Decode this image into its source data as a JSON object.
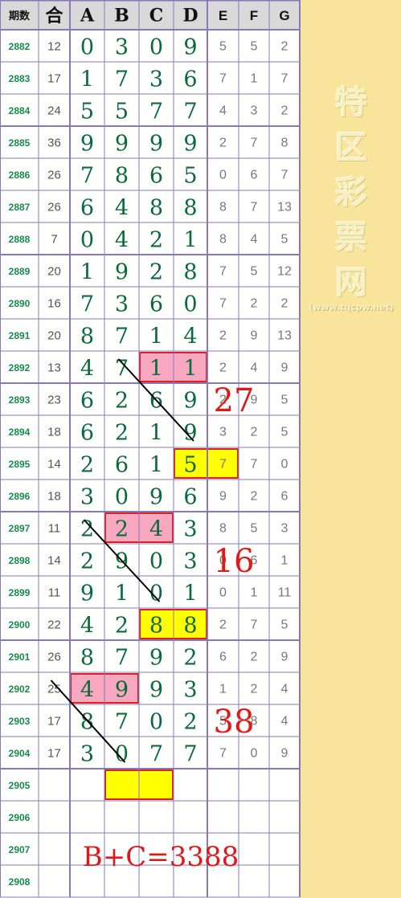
{
  "headers": [
    "期数",
    "合",
    "A",
    "B",
    "C",
    "D",
    "E",
    "F",
    "G"
  ],
  "rows": [
    {
      "issue": "2882",
      "sum": "12",
      "a": "0",
      "b": "3",
      "c": "0",
      "d": "9",
      "e": "5",
      "f": "5",
      "g": "2"
    },
    {
      "issue": "2883",
      "sum": "17",
      "a": "1",
      "b": "7",
      "c": "3",
      "d": "6",
      "e": "7",
      "f": "1",
      "g": "7"
    },
    {
      "issue": "2884",
      "sum": "24",
      "a": "5",
      "b": "5",
      "c": "7",
      "d": "7",
      "e": "4",
      "f": "3",
      "g": "2"
    },
    {
      "issue": "2885",
      "sum": "36",
      "a": "9",
      "b": "9",
      "c": "9",
      "d": "9",
      "e": "2",
      "f": "7",
      "g": "8"
    },
    {
      "issue": "2886",
      "sum": "26",
      "a": "7",
      "b": "8",
      "c": "6",
      "d": "5",
      "e": "0",
      "f": "6",
      "g": "7"
    },
    {
      "issue": "2887",
      "sum": "26",
      "a": "6",
      "b": "4",
      "c": "8",
      "d": "8",
      "e": "8",
      "f": "7",
      "g": "13"
    },
    {
      "issue": "2888",
      "sum": "7",
      "a": "0",
      "b": "4",
      "c": "2",
      "d": "1",
      "e": "8",
      "f": "4",
      "g": "5"
    },
    {
      "issue": "2889",
      "sum": "20",
      "a": "1",
      "b": "9",
      "c": "2",
      "d": "8",
      "e": "7",
      "f": "5",
      "g": "12"
    },
    {
      "issue": "2890",
      "sum": "16",
      "a": "7",
      "b": "3",
      "c": "6",
      "d": "0",
      "e": "7",
      "f": "2",
      "g": "2"
    },
    {
      "issue": "2891",
      "sum": "20",
      "a": "8",
      "b": "7",
      "c": "1",
      "d": "4",
      "e": "2",
      "f": "9",
      "g": "13"
    },
    {
      "issue": "2892",
      "sum": "13",
      "a": "4",
      "b": "7",
      "c": "1",
      "d": "1",
      "e": "2",
      "f": "4",
      "g": "9"
    },
    {
      "issue": "2893",
      "sum": "23",
      "a": "6",
      "b": "2",
      "c": "6",
      "d": "9",
      "e": "2",
      "f": "9",
      "g": "5"
    },
    {
      "issue": "2894",
      "sum": "18",
      "a": "6",
      "b": "2",
      "c": "1",
      "d": "9",
      "e": "3",
      "f": "2",
      "g": "5"
    },
    {
      "issue": "2895",
      "sum": "14",
      "a": "2",
      "b": "6",
      "c": "1",
      "d": "5",
      "e": "7",
      "f": "7",
      "g": "0"
    },
    {
      "issue": "2896",
      "sum": "18",
      "a": "3",
      "b": "0",
      "c": "9",
      "d": "6",
      "e": "9",
      "f": "2",
      "g": "6"
    },
    {
      "issue": "2897",
      "sum": "11",
      "a": "2",
      "b": "2",
      "c": "4",
      "d": "3",
      "e": "8",
      "f": "5",
      "g": "3"
    },
    {
      "issue": "2898",
      "sum": "14",
      "a": "2",
      "b": "9",
      "c": "0",
      "d": "3",
      "e": "0",
      "f": "6",
      "g": "1"
    },
    {
      "issue": "2899",
      "sum": "11",
      "a": "9",
      "b": "1",
      "c": "0",
      "d": "1",
      "e": "0",
      "f": "1",
      "g": "11"
    },
    {
      "issue": "2900",
      "sum": "22",
      "a": "4",
      "b": "2",
      "c": "8",
      "d": "8",
      "e": "2",
      "f": "7",
      "g": "5"
    },
    {
      "issue": "2901",
      "sum": "26",
      "a": "8",
      "b": "7",
      "c": "9",
      "d": "2",
      "e": "6",
      "f": "2",
      "g": "9"
    },
    {
      "issue": "2902",
      "sum": "25",
      "a": "4",
      "b": "9",
      "c": "9",
      "d": "3",
      "e": "1",
      "f": "2",
      "g": "4"
    },
    {
      "issue": "2903",
      "sum": "17",
      "a": "8",
      "b": "7",
      "c": "0",
      "d": "2",
      "e": "5",
      "f": "8",
      "g": "4"
    },
    {
      "issue": "2904",
      "sum": "17",
      "a": "3",
      "b": "0",
      "c": "7",
      "d": "7",
      "e": "7",
      "f": "0",
      "g": "9"
    },
    {
      "issue": "2905",
      "sum": "",
      "a": "",
      "b": "",
      "c": "",
      "d": "",
      "e": "",
      "f": "",
      "g": ""
    },
    {
      "issue": "2906",
      "sum": "",
      "a": "",
      "b": "",
      "c": "",
      "d": "",
      "e": "",
      "f": "",
      "g": ""
    },
    {
      "issue": "2907",
      "sum": "",
      "a": "",
      "b": "",
      "c": "",
      "d": "",
      "e": "",
      "f": "",
      "g": ""
    },
    {
      "issue": "2908",
      "sum": "",
      "a": "",
      "b": "",
      "c": "",
      "d": "",
      "e": "",
      "f": "",
      "g": ""
    }
  ],
  "highlights": [
    {
      "row": 10,
      "cols": [
        4,
        5
      ],
      "color": "#f7a8c0"
    },
    {
      "row": 13,
      "cols": [
        5,
        6
      ],
      "color": "#ffff00"
    },
    {
      "row": 15,
      "cols": [
        3,
        4
      ],
      "color": "#f7a8c0"
    },
    {
      "row": 18,
      "cols": [
        4,
        5
      ],
      "color": "#ffff00"
    },
    {
      "row": 20,
      "cols": [
        2,
        3
      ],
      "color": "#f7a8c0"
    },
    {
      "row": 23,
      "cols": [
        3,
        4
      ],
      "color": "#ffff00"
    }
  ],
  "diagonals": [
    {
      "from": [
        10,
        3
      ],
      "to": [
        12,
        5
      ]
    },
    {
      "from": [
        15,
        2
      ],
      "to": [
        17,
        4
      ]
    },
    {
      "from": [
        20,
        1
      ],
      "to": [
        22,
        3
      ]
    }
  ],
  "annotations": [
    {
      "text": "27",
      "row": 11
    },
    {
      "text": "16",
      "row": 16
    },
    {
      "text": "38",
      "row": 21
    }
  ],
  "formula": "B+C=3388",
  "watermark": {
    "chars": [
      "特",
      "区",
      "彩",
      "票",
      "网"
    ],
    "site": "(www.tqcpw.net)"
  },
  "colors": {
    "grid": "#8878b8",
    "header_bg": "#d9d9d9",
    "issue": "#1a8a4a",
    "sum": "#555555",
    "main": "#0a6a3a",
    "extra": "#777777",
    "annotation": "#e01818",
    "line": "#000000",
    "side": "#f8e49a"
  }
}
